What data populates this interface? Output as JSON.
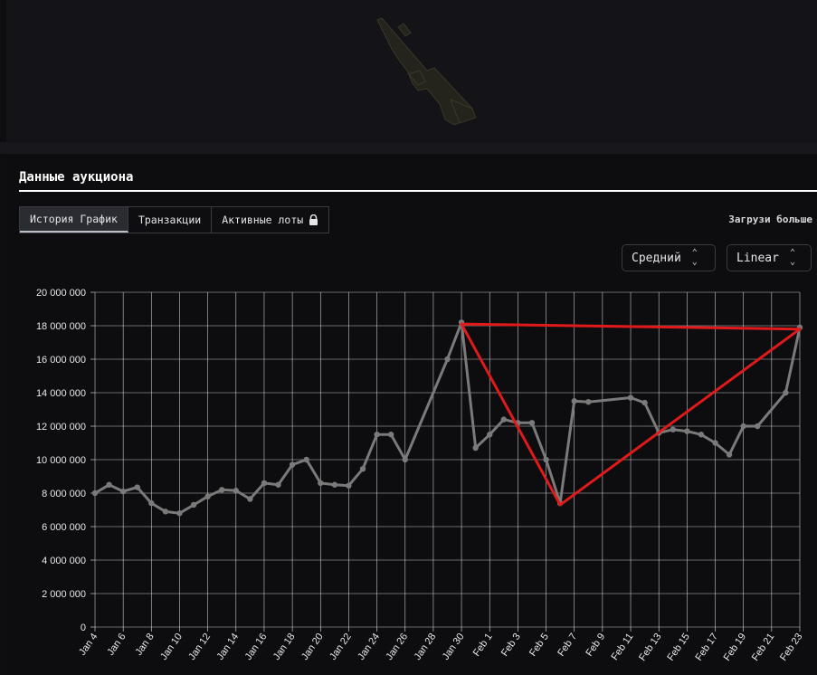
{
  "section": {
    "title": "Данные аукциона"
  },
  "tabs": [
    {
      "label": "История График",
      "active": true
    },
    {
      "label": "Транзакции",
      "active": false
    },
    {
      "label": "Активные лоты",
      "active": false,
      "icon": "lock-icon"
    }
  ],
  "load_more": "Загрузи больше",
  "selects": {
    "aggregation": "Средний",
    "scale": "Linear"
  },
  "colors": {
    "series": "#7a7a7a",
    "overlay": "#e01a1a",
    "grid": "#e6e6e6",
    "background": "#0e0e11"
  },
  "chart_data": {
    "type": "line",
    "ylim": [
      0,
      20000000
    ],
    "y_ticks": [
      "0",
      "2 000 000",
      "4 000 000",
      "6 000 000",
      "8 000 000",
      "10 000 000",
      "12 000 000",
      "14 000 000",
      "16 000 000",
      "18 000 000",
      "20 000 000"
    ],
    "x_ticks": [
      "Jan 4",
      "Jan 6",
      "Jan 8",
      "Jan 10",
      "Jan 12",
      "Jan 14",
      "Jan 16",
      "Jan 18",
      "Jan 20",
      "Jan 22",
      "Jan 24",
      "Jan 26",
      "Jan 28",
      "Jan 30",
      "Feb 1",
      "Feb 3",
      "Feb 5",
      "Feb 7",
      "Feb 9",
      "Feb 11",
      "Feb 13",
      "Feb 15",
      "Feb 17",
      "Feb 19",
      "Feb 21",
      "Feb 23"
    ],
    "grid": true,
    "series": [
      {
        "points": [
          [
            "Jan 4",
            8000000
          ],
          [
            "Jan 5",
            8500000
          ],
          [
            "Jan 6",
            8100000
          ],
          [
            "Jan 7",
            8350000
          ],
          [
            "Jan 8",
            7400000
          ],
          [
            "Jan 9",
            6900000
          ],
          [
            "Jan 10",
            6800000
          ],
          [
            "Jan 11",
            7300000
          ],
          [
            "Jan 12",
            7800000
          ],
          [
            "Jan 13",
            8200000
          ],
          [
            "Jan 14",
            8150000
          ],
          [
            "Jan 15",
            7650000
          ],
          [
            "Jan 16",
            8600000
          ],
          [
            "Jan 17",
            8500000
          ],
          [
            "Jan 18",
            9700000
          ],
          [
            "Jan 19",
            10000000
          ],
          [
            "Jan 20",
            8600000
          ],
          [
            "Jan 21",
            8500000
          ],
          [
            "Jan 22",
            8450000
          ],
          [
            "Jan 23",
            9450000
          ],
          [
            "Jan 24",
            11500000
          ],
          [
            "Jan 25",
            11500000
          ],
          [
            "Jan 26",
            10000000
          ],
          [
            "Jan 29",
            16000000
          ],
          [
            "Jan 30",
            18200000
          ],
          [
            "Jan 31",
            10700000
          ],
          [
            "Feb 1",
            11500000
          ],
          [
            "Feb 2",
            12400000
          ],
          [
            "Feb 3",
            12200000
          ],
          [
            "Feb 4",
            12200000
          ],
          [
            "Feb 5",
            10000000
          ],
          [
            "Feb 6",
            7400000
          ],
          [
            "Feb 7",
            13500000
          ],
          [
            "Feb 8",
            13450000
          ],
          [
            "Feb 11",
            13700000
          ],
          [
            "Feb 12",
            13400000
          ],
          [
            "Feb 13",
            11600000
          ],
          [
            "Feb 14",
            11800000
          ],
          [
            "Feb 15",
            11700000
          ],
          [
            "Feb 16",
            11500000
          ],
          [
            "Feb 17",
            11000000
          ],
          [
            "Feb 18",
            10300000
          ],
          [
            "Feb 19",
            12000000
          ],
          [
            "Feb 20",
            12000000
          ],
          [
            "Feb 22",
            14000000
          ],
          [
            "Feb 23",
            17900000
          ]
        ]
      }
    ],
    "overlay_lines": [
      [
        [
          "Jan 30",
          18100000
        ],
        [
          "Feb 23",
          17800000
        ]
      ],
      [
        [
          "Jan 30",
          18100000
        ],
        [
          "Feb 6",
          7300000
        ]
      ],
      [
        [
          "Feb 6",
          7300000
        ],
        [
          "Feb 23",
          17800000
        ]
      ]
    ]
  }
}
